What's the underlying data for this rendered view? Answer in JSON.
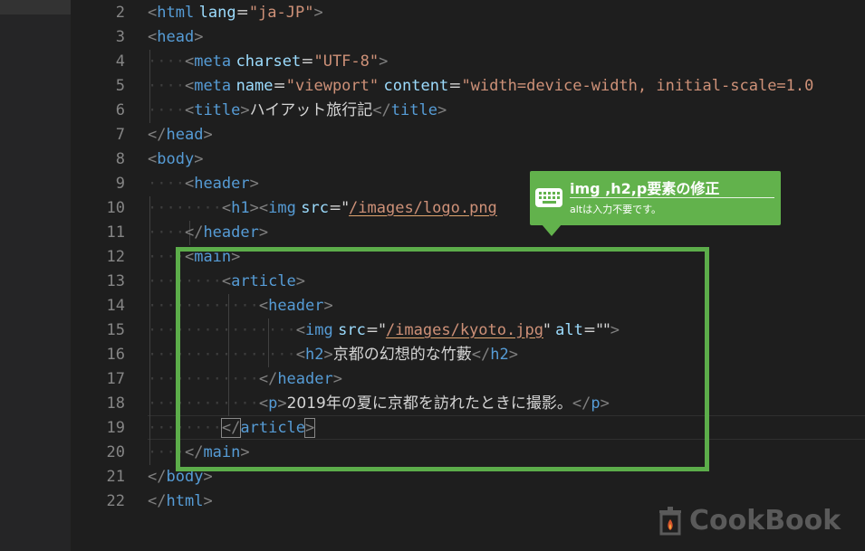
{
  "editor": {
    "line_numbers": [
      "2",
      "3",
      "4",
      "5",
      "6",
      "7",
      "8",
      "9",
      "10",
      "11",
      "12",
      "13",
      "14",
      "15",
      "16",
      "17",
      "18",
      "19",
      "20",
      "21",
      "22"
    ],
    "lines": [
      {
        "t": [
          [
            "tag-bracket",
            "<"
          ],
          [
            "tag-name",
            "html"
          ],
          [
            "txt",
            " "
          ],
          [
            "attr",
            "lang"
          ],
          [
            "txt",
            "="
          ],
          [
            "str",
            "\"ja-JP\""
          ],
          [
            "tag-bracket",
            ">"
          ]
        ]
      },
      {
        "t": [
          [
            "tag-bracket",
            "<"
          ],
          [
            "tag-name",
            "head"
          ],
          [
            "tag-bracket",
            ">"
          ]
        ]
      },
      {
        "t": [
          [
            "ws",
            "····"
          ],
          [
            "tag-bracket",
            "<"
          ],
          [
            "tag-name",
            "meta"
          ],
          [
            "txt",
            " "
          ],
          [
            "attr",
            "charset"
          ],
          [
            "txt",
            "="
          ],
          [
            "str",
            "\"UTF-8\""
          ],
          [
            "tag-bracket",
            ">"
          ]
        ]
      },
      {
        "t": [
          [
            "ws",
            "····"
          ],
          [
            "tag-bracket",
            "<"
          ],
          [
            "tag-name",
            "meta"
          ],
          [
            "txt",
            " "
          ],
          [
            "attr",
            "name"
          ],
          [
            "txt",
            "="
          ],
          [
            "str",
            "\"viewport\""
          ],
          [
            "txt",
            " "
          ],
          [
            "attr",
            "content"
          ],
          [
            "txt",
            "="
          ],
          [
            "str",
            "\"width=device-width, initial-scale=1.0"
          ]
        ]
      },
      {
        "t": [
          [
            "ws",
            "····"
          ],
          [
            "tag-bracket",
            "<"
          ],
          [
            "tag-name",
            "title"
          ],
          [
            "tag-bracket",
            ">"
          ],
          [
            "txt",
            "ハイアット旅行記"
          ],
          [
            "tag-bracket",
            "</"
          ],
          [
            "tag-name",
            "title"
          ],
          [
            "tag-bracket",
            ">"
          ]
        ]
      },
      {
        "t": [
          [
            "tag-bracket",
            "</"
          ],
          [
            "tag-name",
            "head"
          ],
          [
            "tag-bracket",
            ">"
          ]
        ]
      },
      {
        "t": [
          [
            "tag-bracket",
            "<"
          ],
          [
            "tag-name",
            "body"
          ],
          [
            "tag-bracket",
            ">"
          ]
        ]
      },
      {
        "t": [
          [
            "ws",
            "····"
          ],
          [
            "tag-bracket",
            "<"
          ],
          [
            "tag-name",
            "header"
          ],
          [
            "tag-bracket",
            ">"
          ]
        ]
      },
      {
        "t": [
          [
            "ws",
            "········"
          ],
          [
            "tag-bracket",
            "<"
          ],
          [
            "tag-name",
            "h1"
          ],
          [
            "tag-bracket",
            "><"
          ],
          [
            "tag-name",
            "img"
          ],
          [
            "txt",
            " "
          ],
          [
            "attr",
            "src"
          ],
          [
            "txt",
            "=\""
          ],
          [
            "str-u",
            "/images/logo.png"
          ],
          [
            "txt",
            "                      "
          ],
          [
            "tag-name",
            "h1"
          ],
          [
            "tag-bracket",
            ">"
          ]
        ]
      },
      {
        "t": [
          [
            "ws",
            "····"
          ],
          [
            "tag-bracket",
            "</"
          ],
          [
            "tag-name",
            "header"
          ],
          [
            "tag-bracket",
            ">"
          ]
        ]
      },
      {
        "t": [
          [
            "ws",
            "····"
          ],
          [
            "tag-bracket",
            "<"
          ],
          [
            "tag-name",
            "main"
          ],
          [
            "tag-bracket",
            ">"
          ]
        ]
      },
      {
        "t": [
          [
            "ws",
            "········"
          ],
          [
            "tag-bracket",
            "<"
          ],
          [
            "tag-name",
            "article"
          ],
          [
            "tag-bracket",
            ">"
          ]
        ]
      },
      {
        "t": [
          [
            "ws",
            "············"
          ],
          [
            "tag-bracket",
            "<"
          ],
          [
            "tag-name",
            "header"
          ],
          [
            "tag-bracket",
            ">"
          ]
        ]
      },
      {
        "t": [
          [
            "ws",
            "················"
          ],
          [
            "tag-bracket",
            "<"
          ],
          [
            "tag-name",
            "img"
          ],
          [
            "txt",
            " "
          ],
          [
            "attr",
            "src"
          ],
          [
            "txt",
            "=\""
          ],
          [
            "str-u",
            "/images/kyoto.jpg"
          ],
          [
            "txt",
            "\" "
          ],
          [
            "attr",
            "alt"
          ],
          [
            "txt",
            "=\"\""
          ],
          [
            "tag-bracket",
            ">"
          ]
        ]
      },
      {
        "t": [
          [
            "ws",
            "················"
          ],
          [
            "tag-bracket",
            "<"
          ],
          [
            "tag-name",
            "h2"
          ],
          [
            "tag-bracket",
            ">"
          ],
          [
            "txt",
            "京都の幻想的な竹藪"
          ],
          [
            "tag-bracket",
            "</"
          ],
          [
            "tag-name",
            "h2"
          ],
          [
            "tag-bracket",
            ">"
          ]
        ]
      },
      {
        "t": [
          [
            "ws",
            "············"
          ],
          [
            "tag-bracket",
            "</"
          ],
          [
            "tag-name",
            "header"
          ],
          [
            "tag-bracket",
            ">"
          ]
        ]
      },
      {
        "t": [
          [
            "ws",
            "············"
          ],
          [
            "tag-bracket",
            "<"
          ],
          [
            "tag-name",
            "p"
          ],
          [
            "tag-bracket",
            ">"
          ],
          [
            "txt",
            "2019年の夏に京都を訪れたときに撮影。"
          ],
          [
            "tag-bracket",
            "</"
          ],
          [
            "tag-name",
            "p"
          ],
          [
            "tag-bracket",
            ">"
          ]
        ]
      },
      {
        "t": [
          [
            "ws",
            "········"
          ],
          [
            "match",
            "</"
          ],
          [
            "tag-name",
            "article"
          ],
          [
            "match",
            ">"
          ]
        ]
      },
      {
        "t": [
          [
            "ws",
            "····"
          ],
          [
            "tag-bracket",
            "</"
          ],
          [
            "tag-name",
            "main"
          ],
          [
            "tag-bracket",
            ">"
          ]
        ]
      },
      {
        "t": [
          [
            "tag-bracket",
            "</"
          ],
          [
            "tag-name",
            "body"
          ],
          [
            "tag-bracket",
            ">"
          ]
        ]
      },
      {
        "t": [
          [
            "tag-bracket",
            "</"
          ],
          [
            "tag-name",
            "html"
          ],
          [
            "tag-bracket",
            ">"
          ]
        ]
      }
    ]
  },
  "callout": {
    "title": "img ,h2,p要素の修正",
    "subtitle": "altは入力不要です。",
    "icon": "keyboard-icon",
    "color": "#62b24c"
  },
  "highlight": {
    "color": "#5cad4a"
  },
  "watermark": {
    "text": "CookBook",
    "icon": "cooking-pot-icon"
  }
}
